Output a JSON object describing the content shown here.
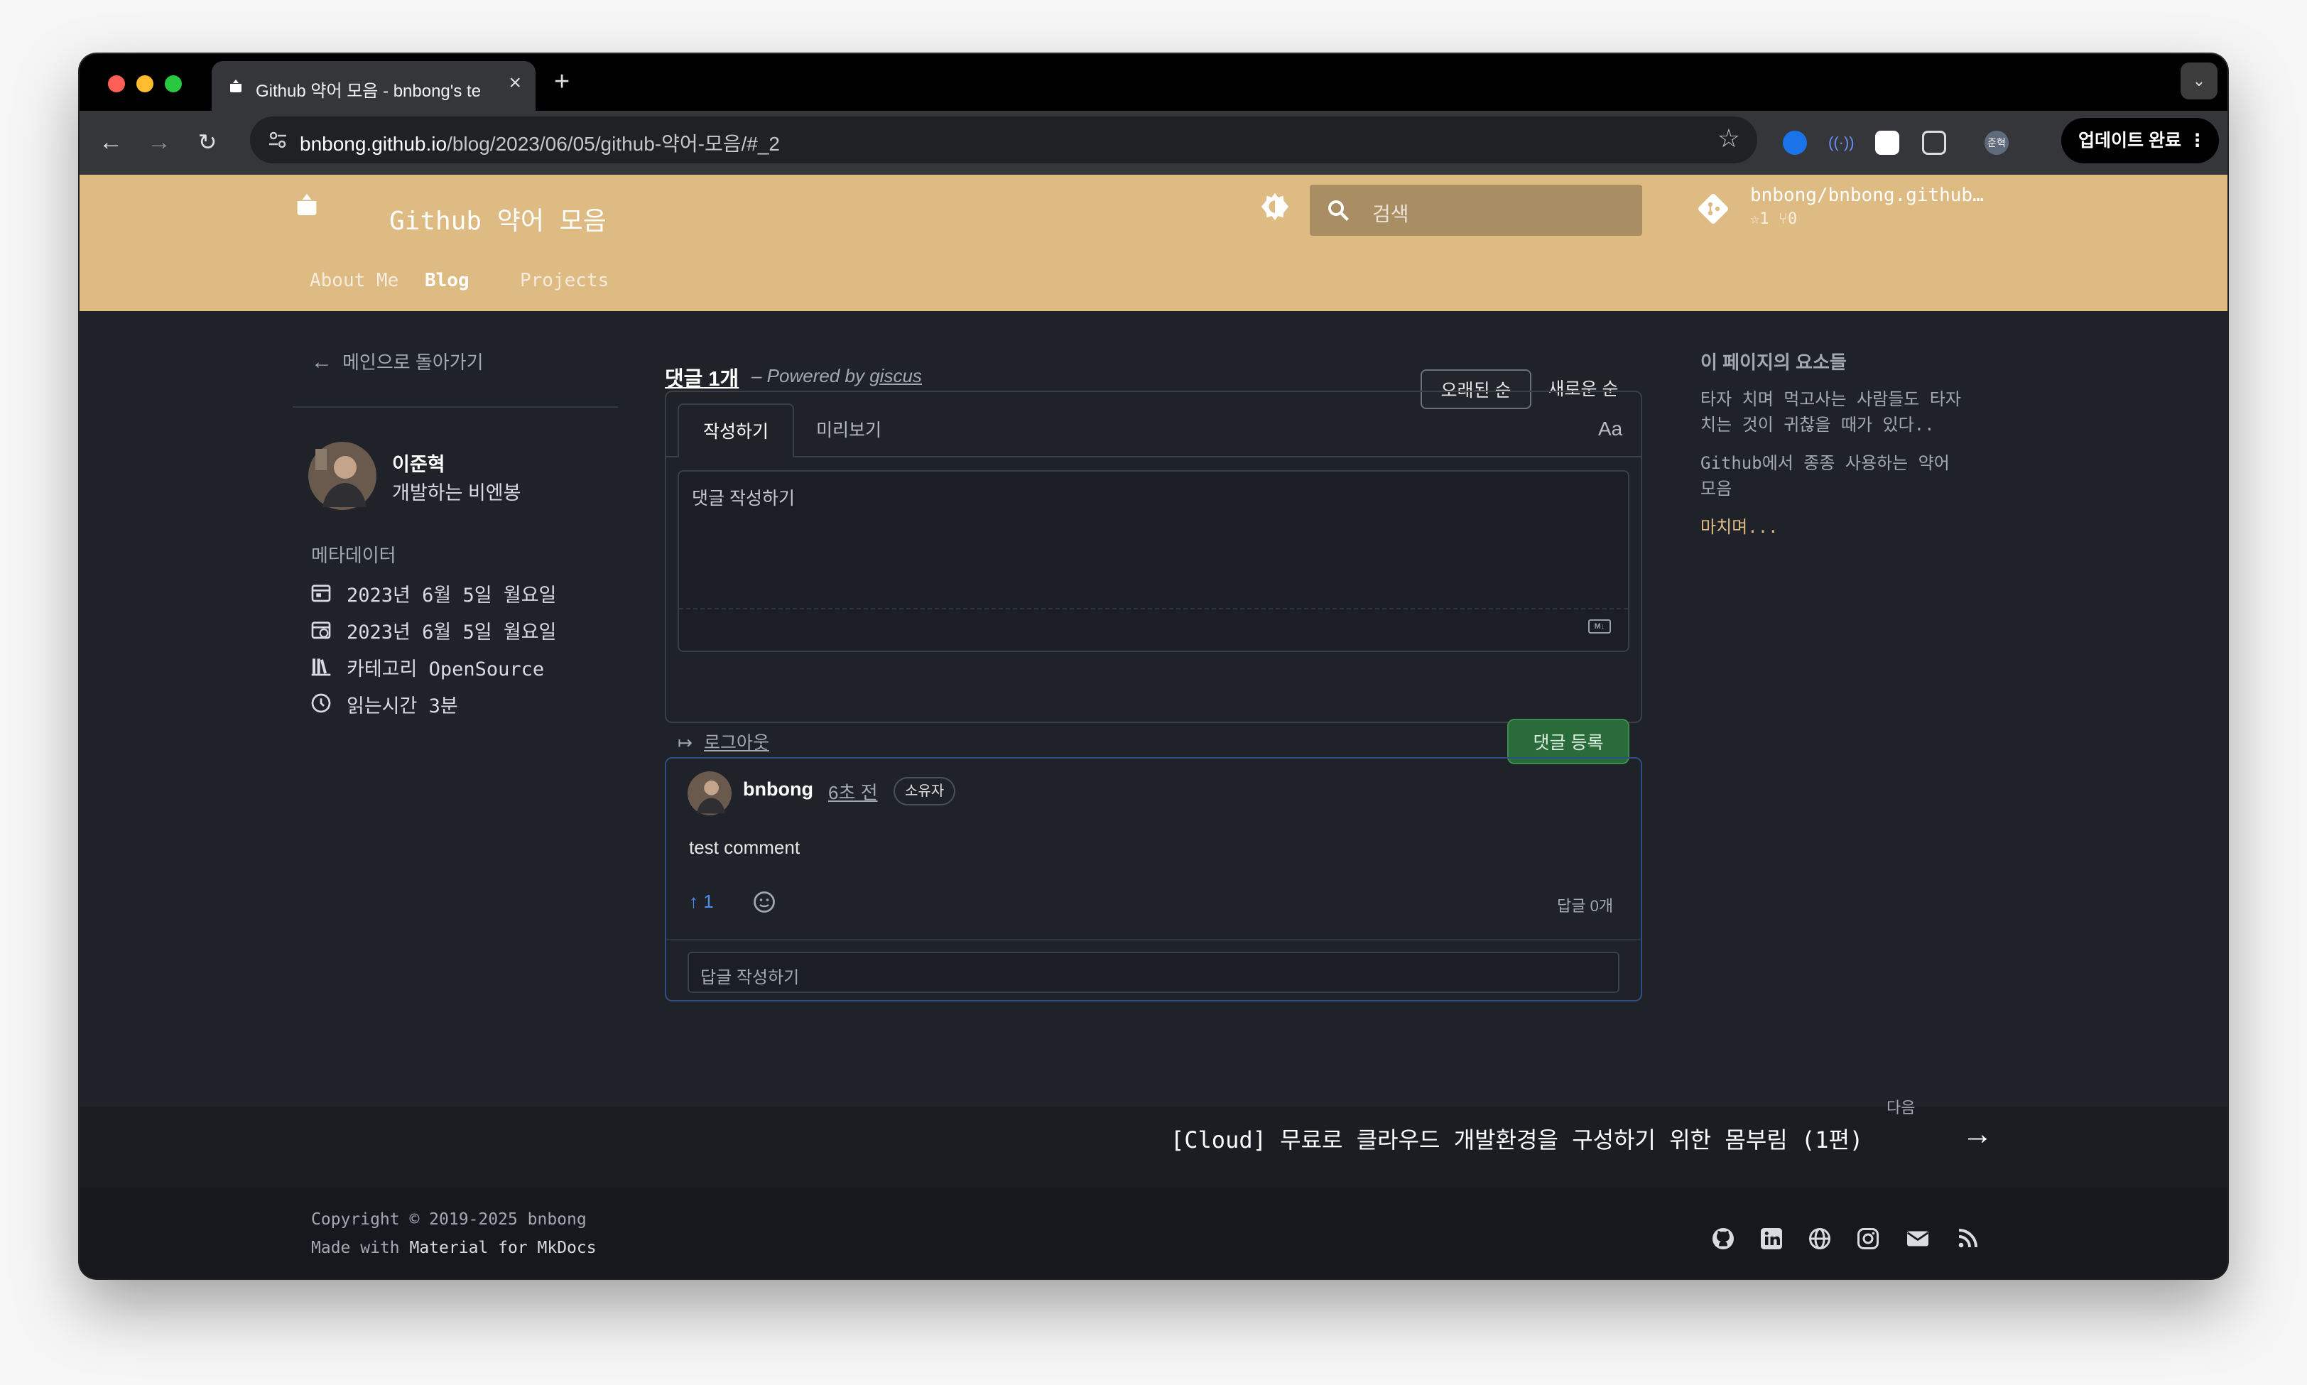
{
  "browser": {
    "tab_title": "Github 약어 모음 - bnbong's te",
    "url_host": "bnbong.github.io",
    "url_path": "/blog/2023/06/05/github-약어-모음/#_2",
    "update_label": "업데이트 완료",
    "profile_label": "준혁",
    "colors": {
      "close": "#ff5f57",
      "minimize": "#febc2e",
      "maximize": "#28c840"
    }
  },
  "header": {
    "site_title": "Github 약어 모음",
    "nav": [
      "About Me",
      "Blog",
      "Projects"
    ],
    "active_nav": "Blog",
    "search_placeholder": "검색",
    "repo_name": "bnbong/bnbong.github…",
    "repo_stars": "1",
    "repo_forks": "0",
    "accent": "#dfbb84"
  },
  "sidebar": {
    "back_label": "메인으로 돌아가기",
    "author_name": "이준혁",
    "author_bio": "개발하는 비엔봉",
    "metadata_title": "메타데이터",
    "created": "2023년 6월 5일 월요일",
    "updated": "2023년 6월 5일 월요일",
    "category": "카테고리 OpenSource",
    "reading_time": "읽는시간 3분"
  },
  "comments": {
    "count_label": "댓글 1개",
    "powered_prefix": "– Powered by",
    "powered_link": "giscus",
    "sort_oldest": "오래된 순",
    "sort_newest": "새로운 순",
    "tab_write": "작성하기",
    "tab_preview": "미리보기",
    "format_label": "Aa",
    "textarea_placeholder": "댓글 작성하기",
    "logout_label": "로그아웃",
    "submit_label": "댓글 등록",
    "comment": {
      "author": "bnbong",
      "time": "6초 전",
      "badge": "소유자",
      "body": "test comment",
      "upvotes": "1",
      "replies_label": "답글 0개",
      "reply_placeholder": "답글 작성하기"
    }
  },
  "toc": {
    "title": "이 페이지의 요소들",
    "items": [
      "타자 치며 먹고사는 사람들도 타자",
      "치는 것이 귀찮을 때가 있다..",
      "Github에서 종종 사용하는 약어",
      "모음",
      "마치며..."
    ],
    "active_index": 4
  },
  "footer": {
    "next_label": "다음",
    "next_title": "[Cloud] 무료로 클라우드 개발환경을 구성하기 위한 몸부림 (1편)",
    "copyright": "Copyright © 2019-2025 bnbong",
    "made_with_prefix": "Made with",
    "made_with_link": "Material for MkDocs",
    "socials": [
      "github-icon",
      "linkedin-icon",
      "globe-icon",
      "instagram-icon",
      "mail-icon",
      "rss-icon"
    ]
  }
}
